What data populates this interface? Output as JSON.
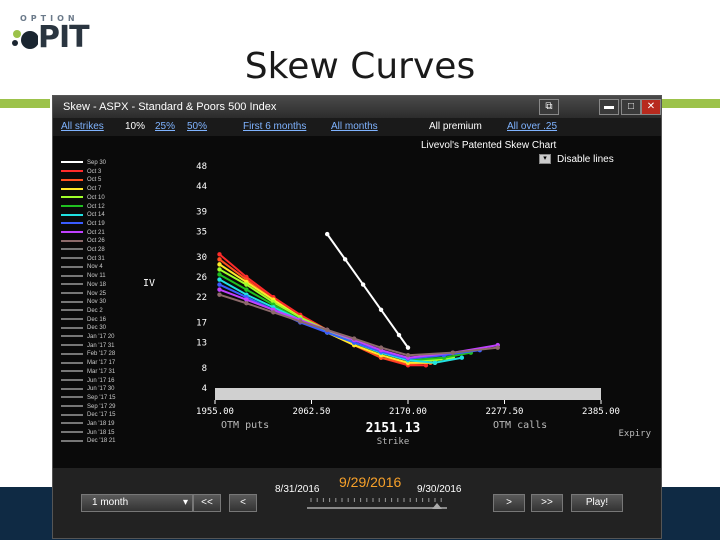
{
  "slide": {
    "logo_top": "OPTION",
    "logo_main": "PIT",
    "title": "Skew Curves"
  },
  "window": {
    "title": "Skew - ASPX - Standard & Poors 500 Index",
    "buttons": [
      "restore",
      "minimize",
      "maximize",
      "close"
    ]
  },
  "filters": {
    "strikes": [
      {
        "label": "All strikes",
        "link": true
      },
      {
        "label": "10%",
        "link": false
      },
      {
        "label": "25%",
        "link": true
      },
      {
        "label": "50%",
        "link": true
      }
    ],
    "months": [
      {
        "label": "First 6 months",
        "link": true
      },
      {
        "label": "All months",
        "link": true
      }
    ],
    "premium": [
      {
        "label": "All premium",
        "link": false
      },
      {
        "label": "All over .25",
        "link": true
      }
    ]
  },
  "chart_title": "Livevol's Patented Skew Chart",
  "disable_lines": "Disable lines",
  "chart_data": {
    "type": "line",
    "ylabel": "IV",
    "xlabel": "Strike",
    "yticks": [
      48,
      44,
      39,
      35,
      30,
      26,
      22,
      17,
      13,
      8,
      4
    ],
    "xticks": [
      "1955.00",
      "2062.50",
      "2170.00",
      "2277.50",
      "2385.00"
    ],
    "ylim": [
      4,
      48
    ],
    "xlim": [
      1955,
      2385
    ],
    "current_price": "2151.13",
    "left_note": "OTM puts",
    "right_note": "OTM calls",
    "corner_note": "Expiry",
    "series": [
      {
        "name": "Sep 30",
        "color": "#ffffff",
        "points": [
          [
            2080,
            34.5
          ],
          [
            2100,
            29.5
          ],
          [
            2120,
            24.5
          ],
          [
            2140,
            19.5
          ],
          [
            2160,
            14.5
          ],
          [
            2170,
            12
          ]
        ]
      },
      {
        "name": "Oct 3",
        "color": "#ff2a2a",
        "points": [
          [
            1960,
            30.5
          ],
          [
            1990,
            26
          ],
          [
            2020,
            22
          ],
          [
            2050,
            18.5
          ],
          [
            2080,
            15.5
          ],
          [
            2110,
            12.5
          ],
          [
            2140,
            10
          ],
          [
            2170,
            8.5
          ],
          [
            2190,
            8.5
          ]
        ]
      },
      {
        "name": "Oct 5",
        "color": "#ff5020",
        "points": [
          [
            1960,
            29.5
          ],
          [
            1990,
            25.5
          ],
          [
            2020,
            21.5
          ],
          [
            2050,
            18
          ],
          [
            2080,
            15
          ],
          [
            2110,
            12.5
          ],
          [
            2140,
            10
          ],
          [
            2170,
            8.8
          ],
          [
            2195,
            9
          ]
        ]
      },
      {
        "name": "Oct 7",
        "color": "#ffe82a",
        "points": [
          [
            1960,
            28.5
          ],
          [
            1990,
            25
          ],
          [
            2020,
            21.5
          ],
          [
            2050,
            18
          ],
          [
            2080,
            15
          ],
          [
            2110,
            12.5
          ],
          [
            2140,
            10.5
          ],
          [
            2170,
            9
          ],
          [
            2200,
            9
          ]
        ]
      },
      {
        "name": "Oct 10",
        "color": "#a0ff2a",
        "points": [
          [
            1960,
            27.5
          ],
          [
            1990,
            24.5
          ],
          [
            2020,
            21
          ],
          [
            2050,
            18
          ],
          [
            2080,
            15.5
          ],
          [
            2110,
            13
          ],
          [
            2140,
            11
          ],
          [
            2170,
            9.5
          ],
          [
            2200,
            9.5
          ],
          [
            2220,
            10
          ]
        ]
      },
      {
        "name": "Oct 12",
        "color": "#20c020",
        "points": [
          [
            1960,
            26.5
          ],
          [
            1990,
            23.5
          ],
          [
            2020,
            20.5
          ],
          [
            2050,
            17.5
          ],
          [
            2080,
            15
          ],
          [
            2110,
            13
          ],
          [
            2140,
            11
          ],
          [
            2170,
            9.5
          ],
          [
            2210,
            10
          ],
          [
            2240,
            11
          ]
        ]
      },
      {
        "name": "Oct 14",
        "color": "#20e0e0",
        "points": [
          [
            1960,
            25.5
          ],
          [
            1990,
            22.5
          ],
          [
            2020,
            20
          ],
          [
            2050,
            17.5
          ],
          [
            2080,
            15
          ],
          [
            2110,
            13
          ],
          [
            2140,
            11
          ],
          [
            2170,
            9.5
          ],
          [
            2200,
            9
          ],
          [
            2230,
            10
          ]
        ]
      },
      {
        "name": "Oct 19",
        "color": "#3a5cff",
        "points": [
          [
            1960,
            24.5
          ],
          [
            1990,
            22
          ],
          [
            2020,
            19.5
          ],
          [
            2050,
            17
          ],
          [
            2080,
            15
          ],
          [
            2110,
            13
          ],
          [
            2140,
            11.2
          ],
          [
            2170,
            9.8
          ],
          [
            2210,
            10.5
          ],
          [
            2250,
            11.5
          ]
        ]
      },
      {
        "name": "Oct 21",
        "color": "#c040ff",
        "points": [
          [
            1960,
            23.5
          ],
          [
            1990,
            21.5
          ],
          [
            2020,
            19.5
          ],
          [
            2050,
            17.5
          ],
          [
            2080,
            15.5
          ],
          [
            2110,
            13.5
          ],
          [
            2140,
            11.5
          ],
          [
            2170,
            10
          ],
          [
            2220,
            11
          ],
          [
            2270,
            12.5
          ]
        ]
      },
      {
        "name": "Oct 26",
        "color": "#8c6a6a",
        "points": [
          [
            1960,
            22.5
          ],
          [
            1990,
            20.8
          ],
          [
            2020,
            19
          ],
          [
            2050,
            17.2
          ],
          [
            2080,
            15.5
          ],
          [
            2110,
            13.8
          ],
          [
            2140,
            12
          ],
          [
            2170,
            10.5
          ],
          [
            2220,
            11
          ],
          [
            2270,
            12
          ]
        ]
      }
    ],
    "legend_dates": [
      "Sep 30",
      "Oct 3",
      "Oct 5",
      "Oct 7",
      "Oct 10",
      "Oct 12",
      "Oct 14",
      "Oct 19",
      "Oct 21",
      "Oct 26",
      "Oct 28",
      "Oct 31",
      "Nov 4",
      "Nov 11",
      "Nov 18",
      "Nov 25",
      "Nov 30",
      "Dec 2",
      "Dec 16",
      "Dec 30",
      "Jan '17 20",
      "Jan '17 31",
      "Feb '17 28",
      "Mar '17 17",
      "Mar '17 31",
      "Jun '17 16",
      "Jun '17 30",
      "Sep '17 15",
      "Sep '17 29",
      "Dec '17 15",
      "Jan '18 19",
      "Jun '18 15",
      "Dec '18 21"
    ],
    "legend_colors": [
      "#ffffff",
      "#ff2a2a",
      "#ff5020",
      "#ffe82a",
      "#a0ff2a",
      "#20c020",
      "#20e0e0",
      "#3a5cff",
      "#c040ff",
      "#8c6a6a",
      "#777777",
      "#777777",
      "#777777",
      "#777777",
      "#777777",
      "#777777",
      "#777777",
      "#777777",
      "#777777",
      "#777777",
      "#777777",
      "#777777",
      "#777777",
      "#777777",
      "#777777",
      "#777777",
      "#777777",
      "#777777",
      "#777777",
      "#777777",
      "#777777",
      "#777777",
      "#777777"
    ]
  },
  "controls": {
    "period": "1 month",
    "prev2": "<<",
    "prev1": "<",
    "next1": ">",
    "next2": ">>",
    "play": "Play!",
    "current_date": "9/29/2016",
    "start_date": "8/31/2016",
    "end_date": "9/30/2016"
  }
}
